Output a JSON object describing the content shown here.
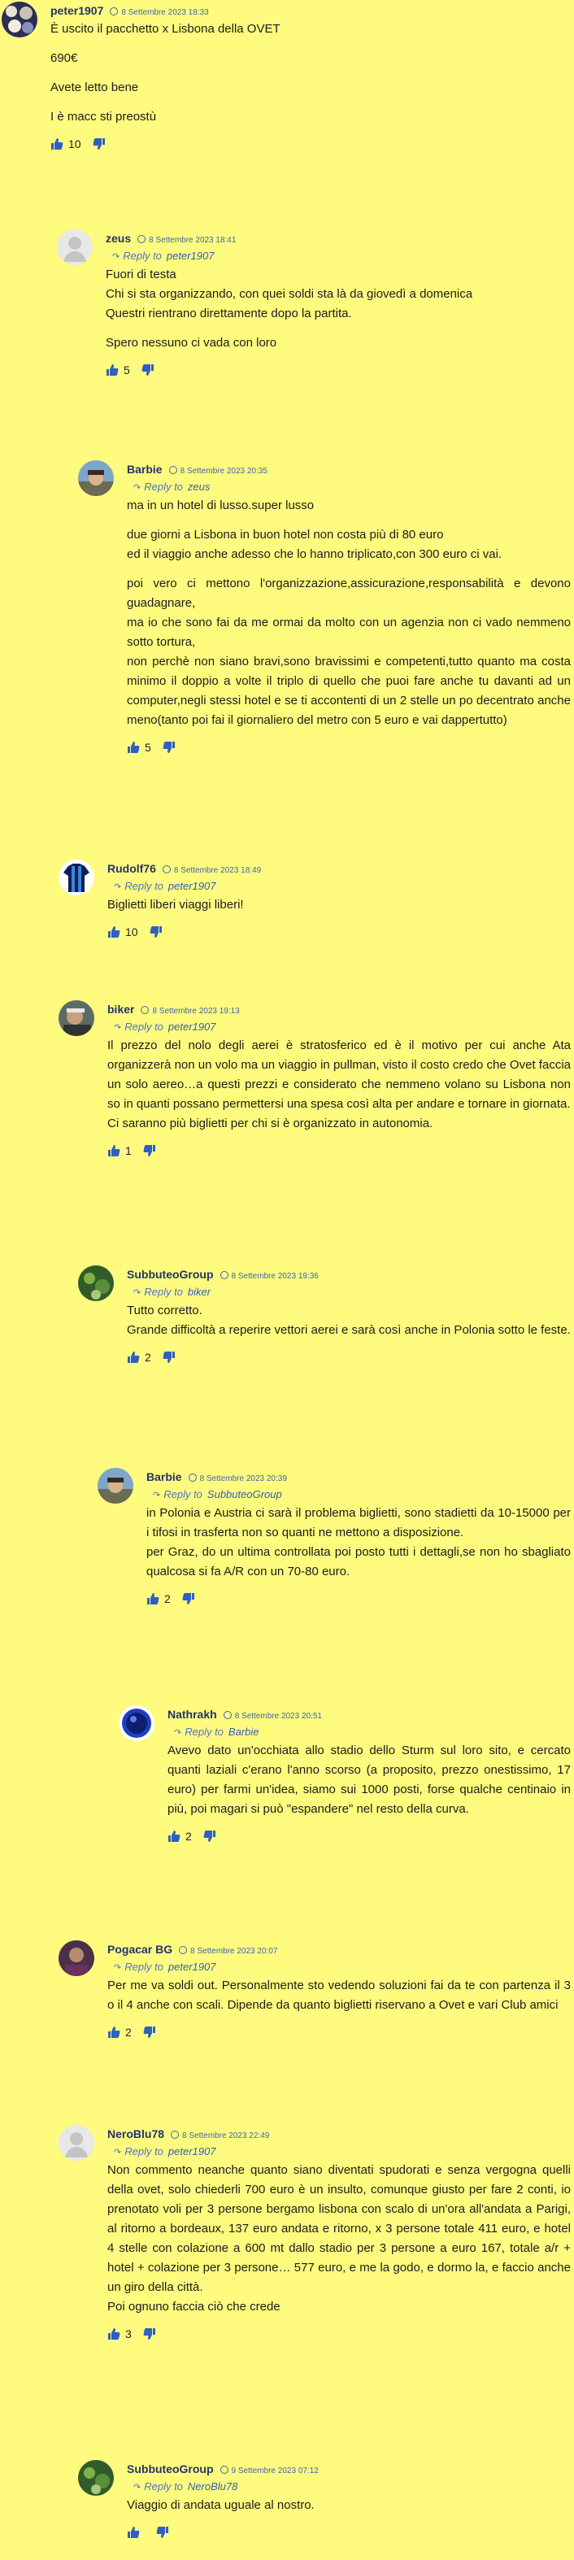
{
  "labels": {
    "reply_to": "Reply to"
  },
  "comments": [
    {
      "author": "peter1907",
      "date": "8 Settembre 2023 18:33",
      "reply_to": "",
      "paragraphs": [
        "È uscito il pacchetto x Lisbona della OVET",
        "690€",
        "Avete letto bene",
        "I è macc sti preostù"
      ],
      "likes": "10"
    },
    {
      "author": "zeus",
      "date": "8 Settembre 2023 18:41",
      "reply_to": "peter1907",
      "paragraphs": [
        "Fuori di testa\nChi si sta organizzando, con quei soldi sta là da giovedì a domenica\nQuestri rientrano direttamente dopo la partita.",
        "Spero nessuno ci vada con loro"
      ],
      "likes": "5"
    },
    {
      "author": "Barbie",
      "date": "8 Settembre 2023 20:35",
      "reply_to": "zeus",
      "paragraphs": [
        "ma in un hotel di lusso.super lusso",
        "due giorni a Lisbona in buon hotel non costa più di 80 euro\ned il viaggio anche adesso che lo hanno triplicato,con 300 euro ci vai.",
        "poi vero ci mettono l'organizzazione,assicurazione,responsabilità e devono guadagnare,\nma io che sono fai da me ormai da molto con un agenzia non ci vado nemmeno sotto tortura,\nnon perchè non siano bravi,sono bravissimi e competenti,tutto quanto ma costa minimo il doppio a volte il triplo di quello che puoi fare anche tu davanti ad un computer,negli stessi hotel e se ti accontenti di un 2 stelle un po decentrato anche meno(tanto poi fai il giornaliero del metro con 5 euro e vai dappertutto)"
      ],
      "likes": "5"
    },
    {
      "author": "Rudolf76",
      "date": "8 Settembre 2023 18:49",
      "reply_to": "peter1907",
      "paragraphs": [
        "Biglietti liberi viaggi liberi!"
      ],
      "likes": "10"
    },
    {
      "author": "biker",
      "date": "8 Settembre 2023 19:13",
      "reply_to": "peter1907",
      "paragraphs": [
        "Il prezzo del nolo degli aerei è stratosferico ed è il motivo per cui anche Ata organizzerà non un volo ma un viaggio in pullman, visto il costo credo che Ovet faccia un solo aereo…a questi prezzi e considerato che nemmeno volano su Lisbona non so in quanti possano permettersi una spesa così alta per andare e tornare in giornata.\nCi saranno più biglietti per chi si è organizzato in autonomia."
      ],
      "likes": "1"
    },
    {
      "author": "SubbuteoGroup",
      "date": "8 Settembre 2023 19:36",
      "reply_to": "biker",
      "paragraphs": [
        "Tutto corretto.\nGrande difficoltà a reperire vettori aerei e sarà così anche in Polonia sotto le feste."
      ],
      "likes": "2"
    },
    {
      "author": "Barbie",
      "date": "8 Settembre 2023 20:39",
      "reply_to": "SubbuteoGroup",
      "paragraphs": [
        "in Polonia e Austria ci sarà il problema biglietti, sono stadietti da 10-15000 per i tifosi in trasferta non so quanti ne mettono a disposizione.\nper Graz, do un ultima controllata poi posto tutti i dettagli,se non ho sbagliato qualcosa si fa A/R con un 70-80 euro."
      ],
      "likes": "2"
    },
    {
      "author": "Nathrakh",
      "date": "8 Settembre 2023 20:51",
      "reply_to": "Barbie",
      "paragraphs": [
        "Avevo dato un'occhiata allo stadio dello Sturm sul loro sito, e cercato quanti laziali c'erano l'anno scorso (a proposito, prezzo onestissimo, 17 euro) per farmi un'idea, siamo sui 1000 posti, forse qualche centinaio in più, poi magari si può \"espandere\" nel resto della curva."
      ],
      "likes": "2"
    },
    {
      "author": "Pogacar BG",
      "date": "8 Settembre 2023 20:07",
      "reply_to": "peter1907",
      "paragraphs": [
        "Per me va soldi out. Personalmente sto vedendo soluzioni fai da te con partenza il 3 o il 4 anche con scali. Dipende da quanto biglietti riservano a Ovet e vari Club amici"
      ],
      "likes": "2"
    },
    {
      "author": "NeroBlu78",
      "date": "8 Settembre 2023 22:49",
      "reply_to": "peter1907",
      "paragraphs": [
        "Non commento neanche quanto siano diventati spudorati e senza vergogna quelli della ovet, solo chiederli 700 euro è un insulto, comunque giusto per fare 2 conti, io prenotato voli per 3 persone bergamo lisbona con scalo di un'ora all'andata a Parigi, al ritorno a bordeaux, 137 euro andata e ritorno, x 3 persone totale 411 euro, e hotel 4 stelle con colazione a 600 mt dallo stadio per 3 persone a euro 167, totale a/r + hotel + colazione per 3 persone… 577 euro, e me la godo, e dormo la, e faccio anche un giro della città.\nPoi ognuno faccia ciò che crede"
      ],
      "likes": "3"
    },
    {
      "author": "SubbuteoGroup",
      "date": "9 Settembre 2023 07:12",
      "reply_to": "NeroBlu78",
      "paragraphs": [
        "Viaggio di andata uguale al nostro."
      ],
      "likes": ""
    }
  ]
}
